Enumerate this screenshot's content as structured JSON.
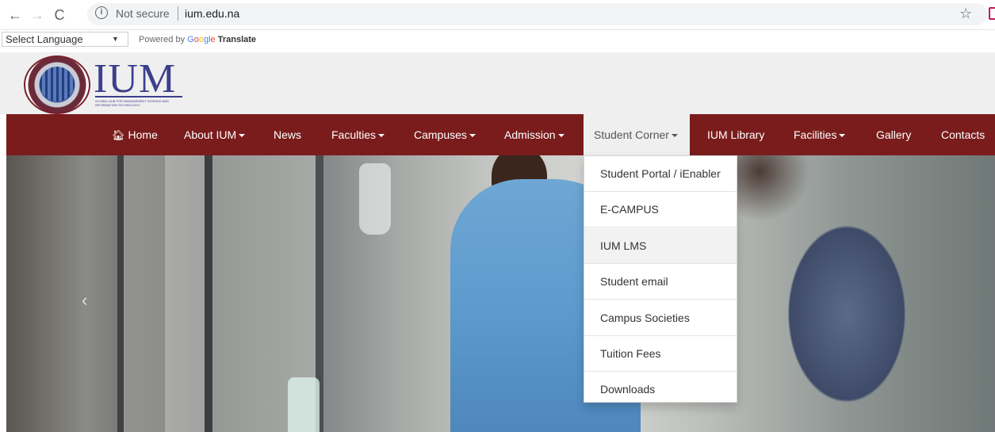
{
  "browser": {
    "security": "Not secure",
    "url": "ium.edu.na"
  },
  "translate": {
    "select_value": "Select Language",
    "powered_by": "Powered by",
    "translate_label": "Translate"
  },
  "logo": {
    "text": "IUM",
    "tagline": "GLOBAL HUB FOR MANAGEMENT SCIENCE AND INFORMATION TECHNOLOGY"
  },
  "nav": {
    "home": "Home",
    "about": "About IUM",
    "news": "News",
    "faculties": "Faculties",
    "campuses": "Campuses",
    "admission": "Admission",
    "student_corner": "Student Corner",
    "library": "IUM Library",
    "facilities": "Facilities",
    "gallery": "Gallery",
    "contacts": "Contacts"
  },
  "dropdown": {
    "items": [
      "Student Portal / iEnabler",
      "E-CAMPUS",
      "IUM LMS",
      "Student email",
      "Campus Societies",
      "Tuition Fees",
      "Downloads"
    ],
    "hovered_index": 2
  },
  "hero": {
    "prev_glyph": "‹"
  },
  "colors": {
    "nav_bg": "#7a1c1c",
    "logo": "#3b3f8c"
  }
}
